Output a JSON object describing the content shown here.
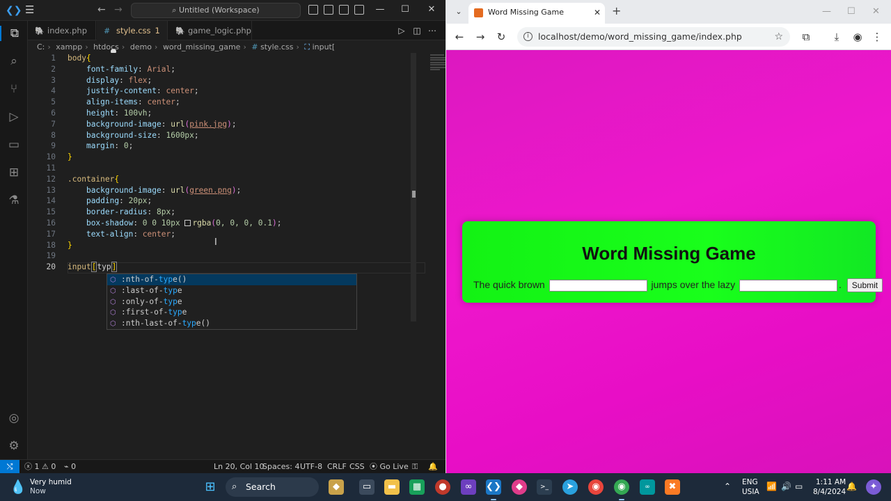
{
  "vscode": {
    "title": "Untitled (Workspace)",
    "menu_icon": "hamburger-icon",
    "tabs": [
      {
        "label": "index.php",
        "type": "php"
      },
      {
        "label": "style.css",
        "type": "css",
        "modified_count": "1",
        "active": true
      },
      {
        "label": "game_logic.php",
        "type": "php"
      }
    ],
    "file_icons": {
      "php": "🐘",
      "css": "#"
    },
    "breadcrumb": [
      "C:",
      "xampp",
      "htdocs",
      "demo",
      "word_missing_game",
      "style.css",
      "input["
    ],
    "line_numbers": [
      "1",
      "2",
      "3",
      "4",
      "5",
      "6",
      "7",
      "8",
      "9",
      "10",
      "11",
      "12",
      "13",
      "14",
      "15",
      "16",
      "17",
      "18",
      "19",
      "20"
    ],
    "code": {
      "l1_sel": "body",
      "l1_brace": "{",
      "l2_prop": "font-family",
      "l2_val": "Arial",
      "l3_prop": "display",
      "l3_val": "flex",
      "l4_prop": "justify-content",
      "l4_val": "center",
      "l5_prop": "align-items",
      "l5_val": "center",
      "l6_prop": "height",
      "l6_val": "100vh",
      "l7_prop": "background-image",
      "l7_fn": "url",
      "l7_val": "pink.jpg",
      "l8_prop": "background-size",
      "l8_val": "1600px",
      "l9_prop": "margin",
      "l9_val": "0",
      "l10_brace": "}",
      "l12_sel": ".container",
      "l12_brace": "{",
      "l13_prop": "background-image",
      "l13_fn": "url",
      "l13_val": "green.png",
      "l14_prop": "padding",
      "l14_val": "20px",
      "l15_prop": "border-radius",
      "l15_val": "8px",
      "l16_prop": "box-shadow",
      "l16_pre": "0 0 10px",
      "l16_fn": "rgba",
      "l16_args": "0, 0, 0, 0.1",
      "l17_prop": "text-align",
      "l17_val": "center",
      "l18_brace": "}",
      "l20_sel": "input",
      "l20_typed": "typ"
    },
    "suggestions": [
      {
        "pre": ":nth-of-",
        "match": "typ",
        "post": "e()"
      },
      {
        "pre": ":last-of-",
        "match": "typ",
        "post": "e"
      },
      {
        "pre": ":only-of-",
        "match": "typ",
        "post": "e"
      },
      {
        "pre": ":first-of-",
        "match": "typ",
        "post": "e"
      },
      {
        "pre": ":nth-last-of-",
        "match": "typ",
        "post": "e()"
      }
    ],
    "status": {
      "errors": "1",
      "warnings": "0",
      "ports": "0",
      "cursor": "Ln 20, Col 10",
      "spaces": "Spaces: 4",
      "encoding": "UTF-8",
      "eol": "CRLF",
      "language": "CSS",
      "golive": "Go Live"
    }
  },
  "chrome": {
    "tab_title": "Word Missing Game",
    "url": "localhost/demo/word_missing_game/index.php",
    "page": {
      "heading": "Word Missing Game",
      "text1": "The quick brown",
      "text2": "jumps over the lazy",
      "text3": ".",
      "submit": "Submit"
    }
  },
  "taskbar": {
    "weather_title": "Very humid",
    "weather_sub": "Now",
    "search": "Search",
    "lang1": "ENG",
    "lang2": "USIA",
    "time": "1:11 AM",
    "date": "8/4/2024"
  },
  "colors": {
    "accent": "#0078d4",
    "game_bg": "#19ff1b",
    "page_bg": "#e815c8"
  }
}
